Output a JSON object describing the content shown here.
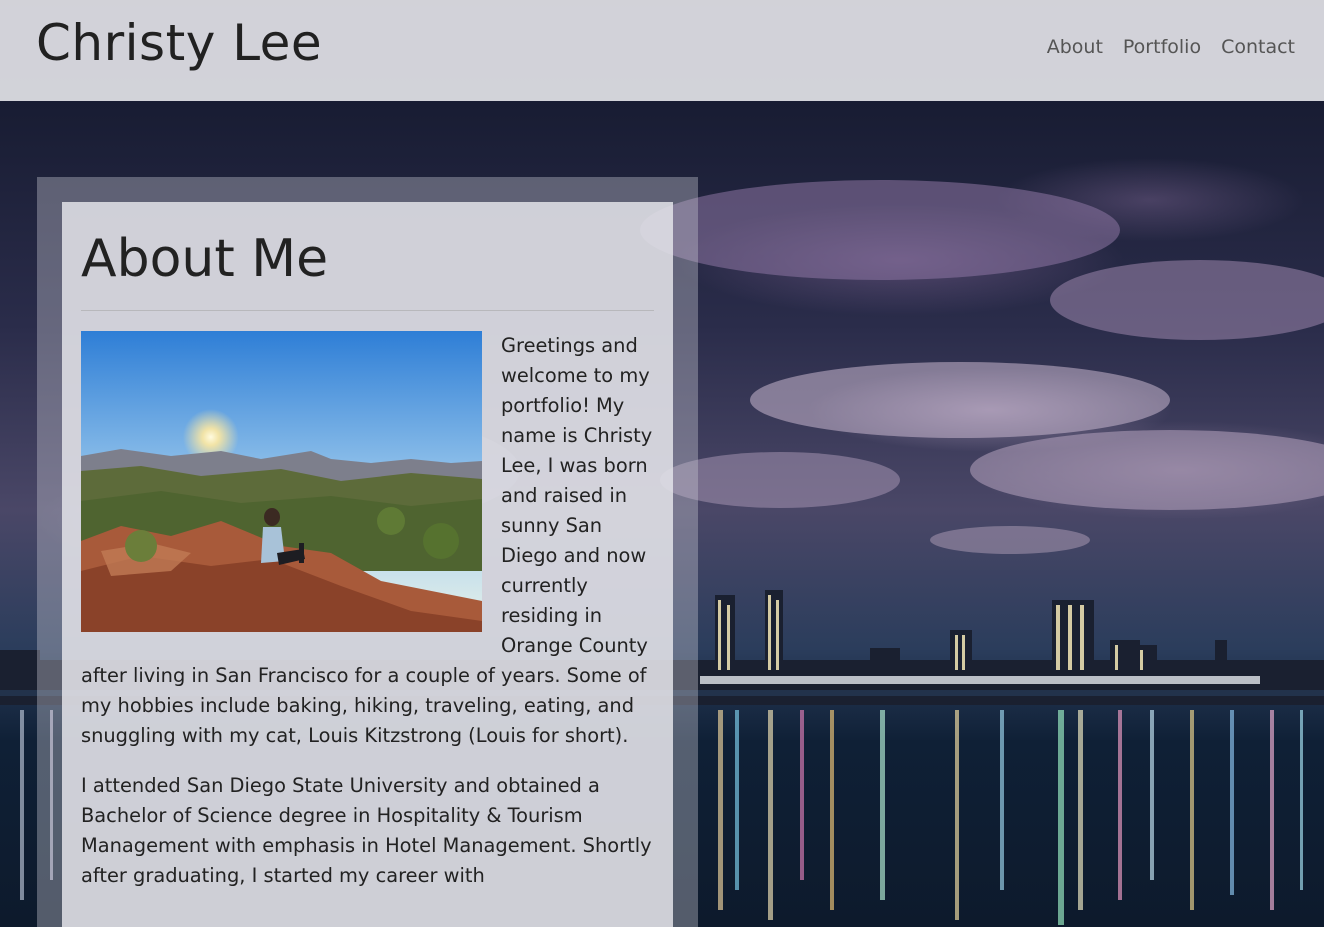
{
  "header": {
    "brand": "Christy Lee",
    "nav": [
      "About",
      "Portfolio",
      "Contact"
    ]
  },
  "about": {
    "heading": "About Me",
    "photo_alt": "Christy sitting on red rocks overlooking a canyon at sunset",
    "paragraphs": [
      "Greetings and welcome to my portfolio! My name is Christy Lee, I was born and raised in sunny San Diego and now currently residing in Orange County after living in San Francisco for a couple of years. Some of my hobbies include baking, hiking, traveling, eating, and snuggling with my cat, Louis Kitzstrong (Louis for short).",
      "I attended San Diego State University and obtained a Bachelor of Science degree in Hospitality & Tourism Management with emphasis in Hotel Management. Shortly after graduating, I started my career with"
    ]
  },
  "colors": {
    "header_bg": "#e1e1e6",
    "text": "#222222",
    "nav_text": "#555555"
  }
}
